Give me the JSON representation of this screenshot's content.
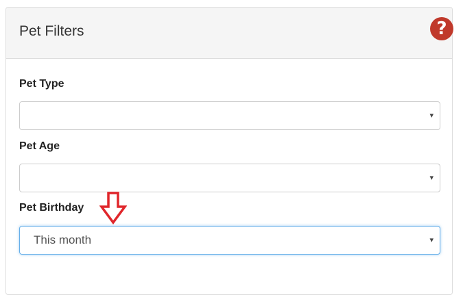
{
  "panel": {
    "title": "Pet Filters",
    "help_icon": "question-mark-icon",
    "help_glyph": "?",
    "accent_color": "#c0392b"
  },
  "filters": [
    {
      "label": "Pet Type",
      "value": ""
    },
    {
      "label": "Pet Age",
      "value": ""
    },
    {
      "label": "Pet Birthday",
      "value": "This month"
    }
  ],
  "caret_glyph": "▾",
  "annotation": {
    "icon": "down-arrow-icon",
    "color": "#e0262b"
  }
}
